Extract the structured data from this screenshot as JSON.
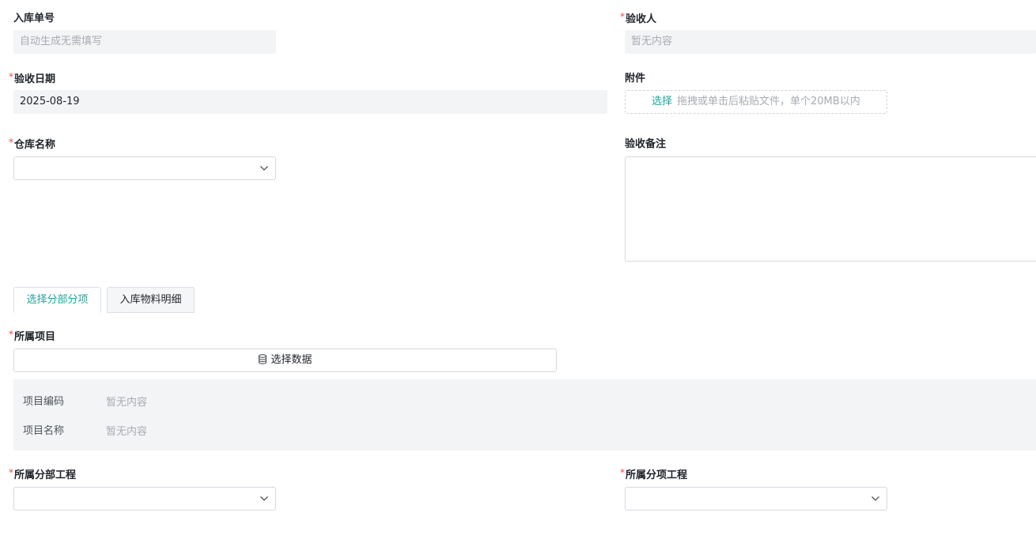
{
  "fields": {
    "inbound_no": {
      "label": "入库单号",
      "required": false,
      "placeholder": "自动生成无需填写"
    },
    "inspector": {
      "label": "验收人",
      "required": true,
      "placeholder": "暂无内容"
    },
    "inspection_date": {
      "label": "验收日期",
      "required": true,
      "value": "2025-08-19"
    },
    "attachment": {
      "label": "附件",
      "required": false,
      "select_label": "选择",
      "hint": "拖拽或单击后粘贴文件，单个20MB以内"
    },
    "warehouse": {
      "label": "仓库名称",
      "required": true,
      "value": ""
    },
    "remark": {
      "label": "验收备注",
      "required": false,
      "value": ""
    }
  },
  "tabs": [
    {
      "label": "选择分部分项",
      "active": true
    },
    {
      "label": "入库物料明细",
      "active": false
    }
  ],
  "project": {
    "label": "所属项目",
    "required": true,
    "select_button_label": "选择数据",
    "info": [
      {
        "key": "项目编码",
        "value": "暂无内容"
      },
      {
        "key": "项目名称",
        "value": "暂无内容"
      }
    ]
  },
  "sub_division": {
    "label": "所属分部工程",
    "required": true,
    "value": ""
  },
  "sub_item": {
    "label": "所属分项工程",
    "required": true,
    "value": ""
  },
  "required_mark": "*",
  "icons": {
    "select_chevron": "chevron-down-icon",
    "data_button": "database-icon"
  },
  "colors": {
    "accent": "#1aa79a",
    "required": "#f5484a",
    "field_bg": "#f3f4f6"
  }
}
